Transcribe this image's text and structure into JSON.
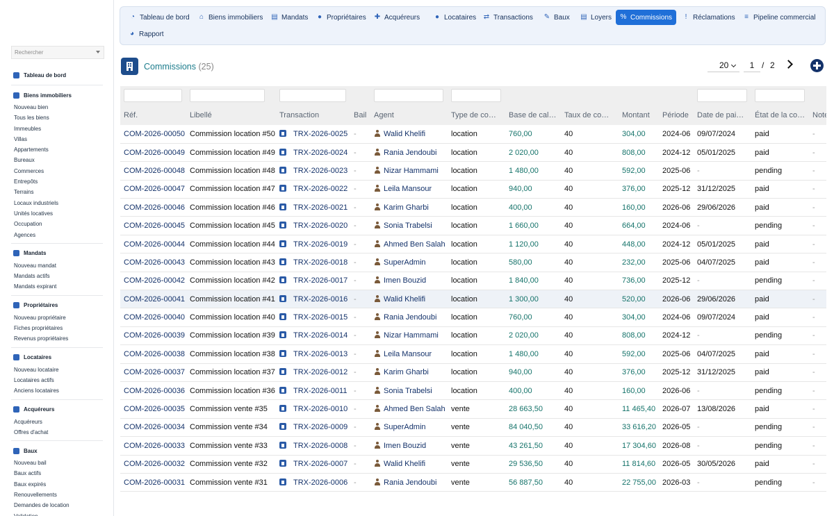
{
  "sidebar": {
    "search_placeholder": "Rechercher",
    "groups": [
      {
        "title": "Tableau de bord",
        "icon": "dashboard-icon",
        "items": []
      },
      {
        "title": "Biens immobiliers",
        "icon": "home-icon",
        "items": [
          "Nouveau bien",
          "Tous les biens",
          "Immeubles",
          "Villas",
          "Appartements",
          "Bureaux",
          "Commerces",
          "Entrepôts",
          "Terrains",
          "Locaux industriels",
          "Unités locatives",
          "Occupation",
          "Agences"
        ]
      },
      {
        "title": "Mandats",
        "icon": "file-icon",
        "items": [
          "Nouveau mandat",
          "Mandats actifs",
          "Mandats expirant"
        ]
      },
      {
        "title": "Propriétaires",
        "icon": "user-tie-icon",
        "items": [
          "Nouveau propriétaire",
          "Fiches propriétaires",
          "Revenus propriétaires"
        ]
      },
      {
        "title": "Locataires",
        "icon": "user-icon",
        "items": [
          "Nouveau locataire",
          "Locataires actifs",
          "Anciens locataires"
        ]
      },
      {
        "title": "Acquéreurs",
        "icon": "user-plus-icon",
        "items": [
          "Acquéreurs",
          "Offres d'achat"
        ]
      },
      {
        "title": "Baux",
        "icon": "lease-icon",
        "items": [
          "Nouveau bail",
          "Baux actifs",
          "Baux expirés",
          "Renouvellements",
          "Demandes de location",
          "Validation"
        ]
      }
    ]
  },
  "topnav": {
    "tabs": [
      {
        "label": "Tableau de bord",
        "icon": "dashboard-icon",
        "glyph": "◔"
      },
      {
        "label": "Biens immobiliers",
        "icon": "home-icon",
        "glyph": "⌂"
      },
      {
        "label": "Mandats",
        "icon": "file-icon",
        "glyph": "▤"
      },
      {
        "label": "Propriétaires",
        "icon": "user-tie-icon",
        "glyph": "●"
      },
      {
        "label": "Acquéreurs",
        "icon": "user-plus-icon",
        "glyph": "✚"
      },
      {
        "label": "Locataires",
        "icon": "user-icon",
        "glyph": "●"
      },
      {
        "label": "Transactions",
        "icon": "handshake-icon",
        "glyph": "⇄"
      },
      {
        "label": "Baux",
        "icon": "lease-icon",
        "glyph": "✎"
      },
      {
        "label": "Loyers",
        "icon": "invoice-icon",
        "glyph": "▤"
      },
      {
        "label": "Commissions",
        "icon": "percent-icon",
        "glyph": "%"
      },
      {
        "label": "Réclamations",
        "icon": "alert-icon",
        "glyph": "!"
      },
      {
        "label": "Pipeline commercial",
        "icon": "list-icon",
        "glyph": "≡"
      },
      {
        "label": "Rapport",
        "icon": "chart-pie-icon",
        "glyph": "◕"
      }
    ],
    "active": "Commissions"
  },
  "page": {
    "title": "Commissions",
    "count": "(25)",
    "page_size": "20",
    "page_current": "1",
    "page_separator": "/",
    "page_total": "2"
  },
  "table": {
    "columns": [
      "Réf.",
      "Libellé",
      "Transaction",
      "Bail",
      "Agent",
      "Type de commission",
      "Base de calcul",
      "Taux de commission",
      "Montant",
      "Période",
      "Date de paiement",
      "État de la commission",
      "Notes"
    ],
    "rows": [
      [
        "COM-2026-00050",
        "Commission location #50",
        "TRX-2026-0025",
        "-",
        "Walid Khelifi",
        "location",
        "760,00",
        "40",
        "304,00",
        "2024-06",
        "09/07/2024",
        "paid",
        "-"
      ],
      [
        "COM-2026-00049",
        "Commission location #49",
        "TRX-2026-0024",
        "-",
        "Rania Jendoubi",
        "location",
        "2 020,00",
        "40",
        "808,00",
        "2024-12",
        "05/01/2025",
        "paid",
        "-"
      ],
      [
        "COM-2026-00048",
        "Commission location #48",
        "TRX-2026-0023",
        "-",
        "Nizar Hammami",
        "location",
        "1 480,00",
        "40",
        "592,00",
        "2025-06",
        "-",
        "pending",
        "-"
      ],
      [
        "COM-2026-00047",
        "Commission location #47",
        "TRX-2026-0022",
        "-",
        "Leila Mansour",
        "location",
        "940,00",
        "40",
        "376,00",
        "2025-12",
        "31/12/2025",
        "paid",
        "-"
      ],
      [
        "COM-2026-00046",
        "Commission location #46",
        "TRX-2026-0021",
        "-",
        "Karim Gharbi",
        "location",
        "400,00",
        "40",
        "160,00",
        "2026-06",
        "29/06/2026",
        "paid",
        "-"
      ],
      [
        "COM-2026-00045",
        "Commission location #45",
        "TRX-2026-0020",
        "-",
        "Sonia Trabelsi",
        "location",
        "1 660,00",
        "40",
        "664,00",
        "2024-06",
        "-",
        "pending",
        "-"
      ],
      [
        "COM-2026-00044",
        "Commission location #44",
        "TRX-2026-0019",
        "-",
        "Ahmed Ben Salah",
        "location",
        "1 120,00",
        "40",
        "448,00",
        "2024-12",
        "05/01/2025",
        "paid",
        "-"
      ],
      [
        "COM-2026-00043",
        "Commission location #43",
        "TRX-2026-0018",
        "-",
        "SuperAdmin",
        "location",
        "580,00",
        "40",
        "232,00",
        "2025-06",
        "04/07/2025",
        "paid",
        "-"
      ],
      [
        "COM-2026-00042",
        "Commission location #42",
        "TRX-2026-0017",
        "-",
        "Imen Bouzid",
        "location",
        "1 840,00",
        "40",
        "736,00",
        "2025-12",
        "-",
        "pending",
        "-"
      ],
      [
        "COM-2026-00041",
        "Commission location #41",
        "TRX-2026-0016",
        "-",
        "Walid Khelifi",
        "location",
        "1 300,00",
        "40",
        "520,00",
        "2026-06",
        "29/06/2026",
        "paid",
        "-"
      ],
      [
        "COM-2026-00040",
        "Commission location #40",
        "TRX-2026-0015",
        "-",
        "Rania Jendoubi",
        "location",
        "760,00",
        "40",
        "304,00",
        "2024-06",
        "09/07/2024",
        "paid",
        "-"
      ],
      [
        "COM-2026-00039",
        "Commission location #39",
        "TRX-2026-0014",
        "-",
        "Nizar Hammami",
        "location",
        "2 020,00",
        "40",
        "808,00",
        "2024-12",
        "-",
        "pending",
        "-"
      ],
      [
        "COM-2026-00038",
        "Commission location #38",
        "TRX-2026-0013",
        "-",
        "Leila Mansour",
        "location",
        "1 480,00",
        "40",
        "592,00",
        "2025-06",
        "04/07/2025",
        "paid",
        "-"
      ],
      [
        "COM-2026-00037",
        "Commission location #37",
        "TRX-2026-0012",
        "-",
        "Karim Gharbi",
        "location",
        "940,00",
        "40",
        "376,00",
        "2025-12",
        "31/12/2025",
        "paid",
        "-"
      ],
      [
        "COM-2026-00036",
        "Commission location #36",
        "TRX-2026-0011",
        "-",
        "Sonia Trabelsi",
        "location",
        "400,00",
        "40",
        "160,00",
        "2026-06",
        "-",
        "pending",
        "-"
      ],
      [
        "COM-2026-00035",
        "Commission vente #35",
        "TRX-2026-0010",
        "-",
        "Ahmed Ben Salah",
        "vente",
        "28 663,50",
        "40",
        "11 465,40",
        "2026-07",
        "13/08/2026",
        "paid",
        "-"
      ],
      [
        "COM-2026-00034",
        "Commission vente #34",
        "TRX-2026-0009",
        "-",
        "SuperAdmin",
        "vente",
        "84 040,50",
        "40",
        "33 616,20",
        "2026-05",
        "-",
        "pending",
        "-"
      ],
      [
        "COM-2026-00033",
        "Commission vente #33",
        "TRX-2026-0008",
        "-",
        "Imen Bouzid",
        "vente",
        "43 261,50",
        "40",
        "17 304,60",
        "2026-08",
        "-",
        "pending",
        "-"
      ],
      [
        "COM-2026-00032",
        "Commission vente #32",
        "TRX-2026-0007",
        "-",
        "Walid Khelifi",
        "vente",
        "29 536,50",
        "40",
        "11 814,60",
        "2026-05",
        "30/05/2026",
        "paid",
        "-"
      ],
      [
        "COM-2026-00031",
        "Commission vente #31",
        "TRX-2026-0006",
        "-",
        "Rania Jendoubi",
        "vente",
        "56 887,50",
        "40",
        "22 755,00",
        "2026-03",
        "-",
        "pending",
        "-"
      ]
    ],
    "highlighted_row": 9
  },
  "colors": {
    "link": "#14326a",
    "amount": "#15736a",
    "accent": "#1f6fd8"
  }
}
